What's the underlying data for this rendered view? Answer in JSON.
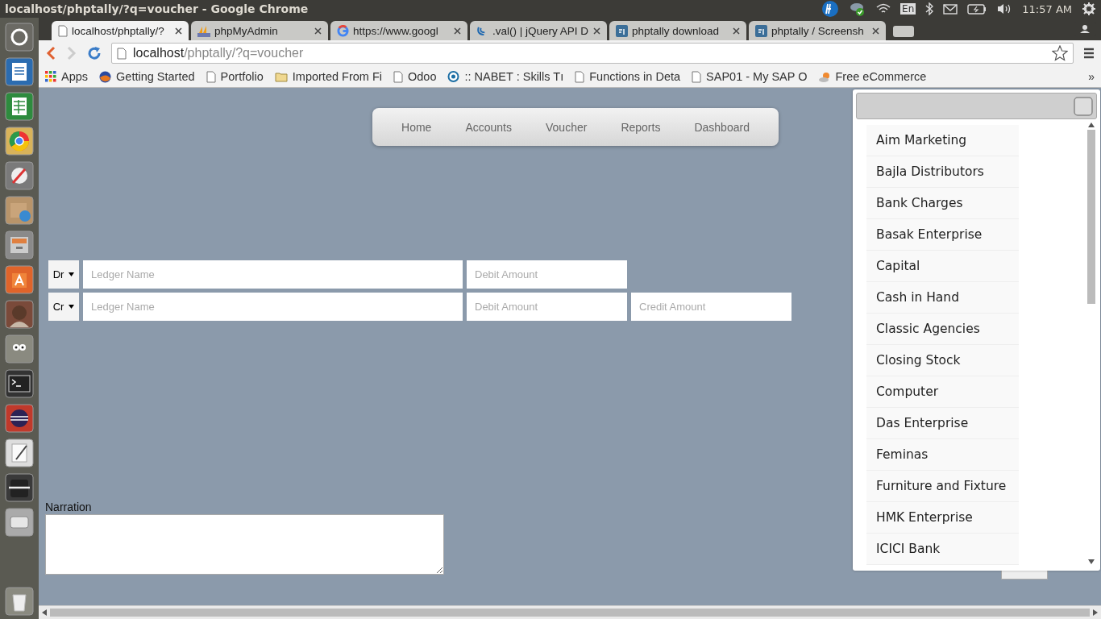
{
  "system_bar": {
    "title": "localhost/phptally/?q=voucher - Google Chrome",
    "language": "En",
    "time": "11:57 AM"
  },
  "tabs": [
    {
      "title": "localhost/phptally/?",
      "selected": true,
      "kind": "page"
    },
    {
      "title": "phpMyAdmin",
      "selected": false,
      "kind": "pma"
    },
    {
      "title": "https://www.googl",
      "selected": false,
      "kind": "google"
    },
    {
      "title": ".val() | jQuery API D",
      "selected": false,
      "kind": "jquery"
    },
    {
      "title": "phptally download",
      "selected": false,
      "kind": "sf"
    },
    {
      "title": "phptally / Screensh",
      "selected": false,
      "kind": "sf"
    }
  ],
  "address_bar": {
    "host": "localhost",
    "path": "/phptally/?q=voucher"
  },
  "bookmarks": [
    {
      "label": "Apps",
      "kind": "apps"
    },
    {
      "label": "Getting Started",
      "kind": "firefox"
    },
    {
      "label": "Portfolio",
      "kind": "page"
    },
    {
      "label": "Imported From Fi",
      "kind": "folder"
    },
    {
      "label": "Odoo",
      "kind": "page"
    },
    {
      "label": ":: NABET : Skills Tı",
      "kind": "nabet"
    },
    {
      "label": "Functions in Deta",
      "kind": "page"
    },
    {
      "label": "SAP01 - My SAP O",
      "kind": "page"
    },
    {
      "label": "Free eCommerce",
      "kind": "store"
    }
  ],
  "bookmarks_more": "»",
  "nav": {
    "items": [
      "Home",
      "Accounts",
      "Voucher",
      "Reports",
      "Dashboard"
    ]
  },
  "entries": [
    {
      "side": "Dr",
      "fields": [
        {
          "kind": "ledger",
          "placeholder": "Ledger Name"
        },
        {
          "kind": "amount",
          "placeholder": "Debit Amount"
        }
      ]
    },
    {
      "side": "Cr",
      "fields": [
        {
          "kind": "ledger",
          "placeholder": "Ledger Name"
        },
        {
          "kind": "amount",
          "placeholder": "Debit Amount"
        },
        {
          "kind": "amount",
          "placeholder": "Credit Amount"
        }
      ]
    }
  ],
  "narration": {
    "label": "Narration"
  },
  "dropdown": {
    "items": [
      "Aim Marketing",
      "Bajla Distributors",
      "Bank Charges",
      "Basak Enterprise",
      "Capital",
      "Cash in Hand",
      "Classic Agencies",
      "Closing Stock",
      "Computer",
      "Das Enterprise",
      "Feminas",
      "Furniture and Fixture",
      "HMK Enterprise",
      "ICICI Bank"
    ]
  }
}
